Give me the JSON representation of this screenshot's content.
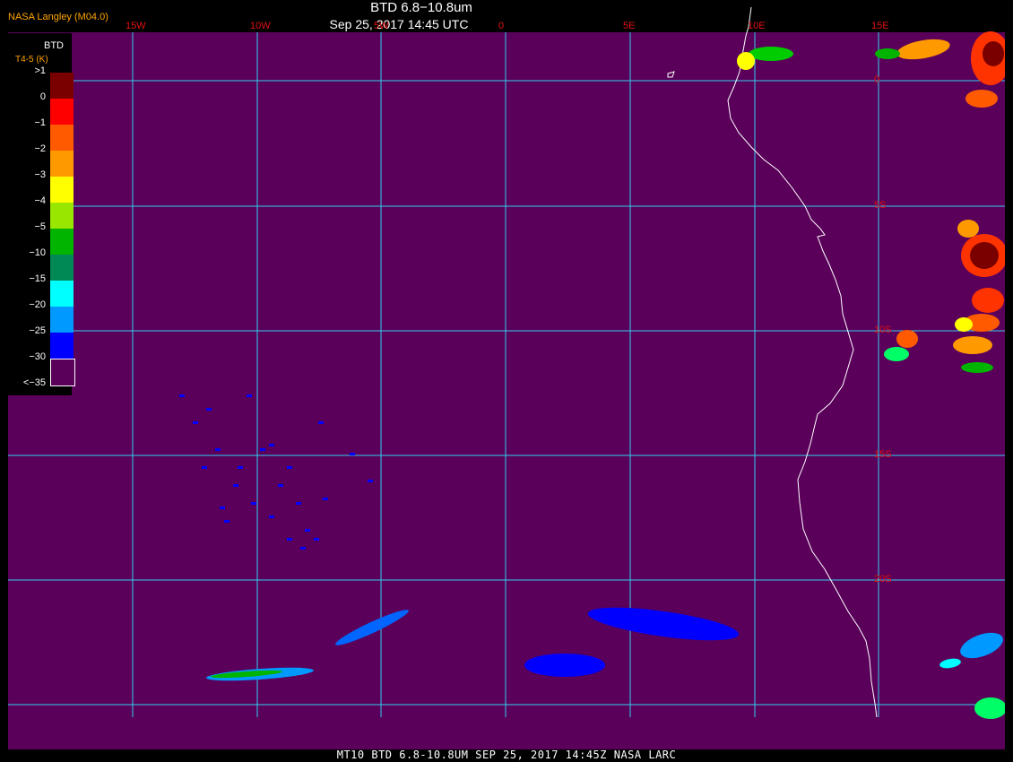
{
  "header": {
    "agency": "NASA Langley (M04.0)",
    "title": "BTD 6.8−10.8um",
    "subtitle": "Sep 25, 2017 14:45 UTC"
  },
  "footer": "MT10  BTD 6.8-10.8UM   SEP 25, 2017 14:45Z   NASA LARC",
  "legend": {
    "title": "BTD",
    "units": "T4-5 (K)",
    "entries": [
      {
        "label": ">1",
        "color": "#7a0000"
      },
      {
        "label": "0",
        "color": "#ff0000"
      },
      {
        "label": "−1",
        "color": "#ff5a00"
      },
      {
        "label": "−2",
        "color": "#ff9900"
      },
      {
        "label": "−3",
        "color": "#ffff00"
      },
      {
        "label": "−4",
        "color": "#99e600"
      },
      {
        "label": "−5",
        "color": "#00b400"
      },
      {
        "label": "−10",
        "color": "#008855"
      },
      {
        "label": "−15",
        "color": "#00ffff"
      },
      {
        "label": "−20",
        "color": "#0099ff"
      },
      {
        "label": "−25",
        "color": "#0000ff"
      },
      {
        "label": "−30",
        "color": "#5a005a"
      },
      {
        "label": "<−35",
        "color": ""
      }
    ]
  },
  "map": {
    "background_color": "#5a005a",
    "grid_color": "#33ccee",
    "coast_color": "#ffffff",
    "lon_labels": [
      "15W",
      "10W",
      "5W",
      "0",
      "5E",
      "10E",
      "15E"
    ],
    "lat_labels": [
      "0",
      "5S",
      "10S",
      "15S",
      "20S"
    ]
  }
}
